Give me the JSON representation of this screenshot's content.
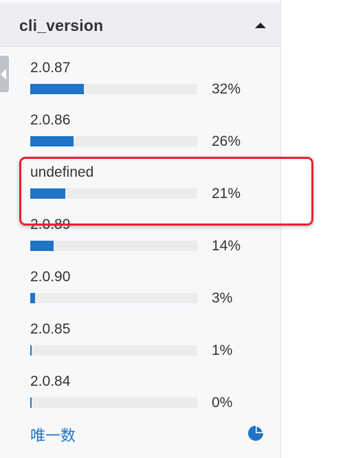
{
  "panel": {
    "title": "cli_version",
    "items": [
      {
        "label": "2.0.87",
        "percent_text": "32%",
        "percent": 32
      },
      {
        "label": "2.0.86",
        "percent_text": "26%",
        "percent": 26
      },
      {
        "label": "undefined",
        "percent_text": "21%",
        "percent": 21
      },
      {
        "label": "2.0.89",
        "percent_text": "14%",
        "percent": 14
      },
      {
        "label": "2.0.90",
        "percent_text": "3%",
        "percent": 3
      },
      {
        "label": "2.0.85",
        "percent_text": "1%",
        "percent": 1
      },
      {
        "label": "2.0.84",
        "percent_text": "0%",
        "percent": 0
      }
    ],
    "footer": {
      "unique_label": "唯一数",
      "icon": "pie-chart-icon"
    }
  },
  "colors": {
    "bar": "#1f74c7",
    "highlight": "#e8202f",
    "link": "#1f74c7"
  },
  "highlight": {
    "target_item": "undefined"
  }
}
